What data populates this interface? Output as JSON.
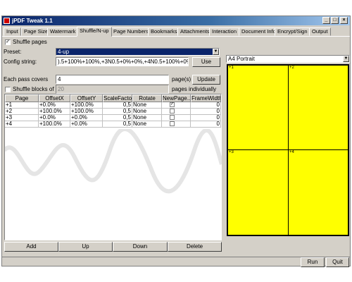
{
  "window": {
    "title": "jPDF Tweak 1.1",
    "minimize": "_",
    "maximize": "□",
    "close": "×"
  },
  "tabs": [
    {
      "label": "Input"
    },
    {
      "label": "Page Size"
    },
    {
      "label": "Watermark"
    },
    {
      "label": "Shuffle/N-up"
    },
    {
      "label": "Page Numbers"
    },
    {
      "label": "Bookmarks"
    },
    {
      "label": "Attachments"
    },
    {
      "label": "Interaction"
    },
    {
      "label": "Document Info"
    },
    {
      "label": "Encrypt/Sign"
    },
    {
      "label": "Output"
    }
  ],
  "shuffle": {
    "shuffle_pages_label": "Shuffle pages",
    "shuffle_pages_checked": "✓",
    "preset_label": "Preset:",
    "preset_value": "4-up",
    "config_label": "Config string:",
    "config_value": ").5+100%+100%,+3N0.5+0%+0%,+4N0.5+100%+0%,",
    "use_button": "Use",
    "each_pass_label": "Each pass covers",
    "each_pass_value": "4",
    "pages_suffix": "page(s)",
    "update_button": "Update",
    "shuffle_blocks_label": "Shuffle blocks of",
    "shuffle_blocks_value": "20",
    "pages_individually": "pages individually"
  },
  "table": {
    "headers": [
      "Page",
      "OffsetX",
      "OffsetY",
      "ScaleFactor",
      "Rotate",
      "NewPage...",
      "FrameWidth"
    ],
    "rows": [
      {
        "page": "+1",
        "offx": "+0.0%",
        "offy": "+100.0%",
        "scale": "0,5",
        "rotate": "None",
        "newpage": "✓",
        "frame": "0"
      },
      {
        "page": "+2",
        "offx": "+100.0%",
        "offy": "+100.0%",
        "scale": "0,5",
        "rotate": "None",
        "newpage": "",
        "frame": "0"
      },
      {
        "page": "+3",
        "offx": "+0.0%",
        "offy": "+0.0%",
        "scale": "0,5",
        "rotate": "None",
        "newpage": "",
        "frame": "0"
      },
      {
        "page": "+4",
        "offx": "+100.0%",
        "offy": "+0.0%",
        "scale": "0,5",
        "rotate": "None",
        "newpage": "",
        "frame": "0"
      }
    ]
  },
  "row_buttons": {
    "add": "Add",
    "up": "Up",
    "down": "Down",
    "delete": "Delete"
  },
  "preview": {
    "paper_size": "A4 Portrait",
    "cells": [
      "+1",
      "+2",
      "+3",
      "+4"
    ],
    "page_color": "#ffff00"
  },
  "footer": {
    "run": "Run",
    "quit": "Quit"
  },
  "colors": {
    "titlebar": "#0a246a",
    "face": "#d4d0c8",
    "selection": "#0a246a"
  }
}
